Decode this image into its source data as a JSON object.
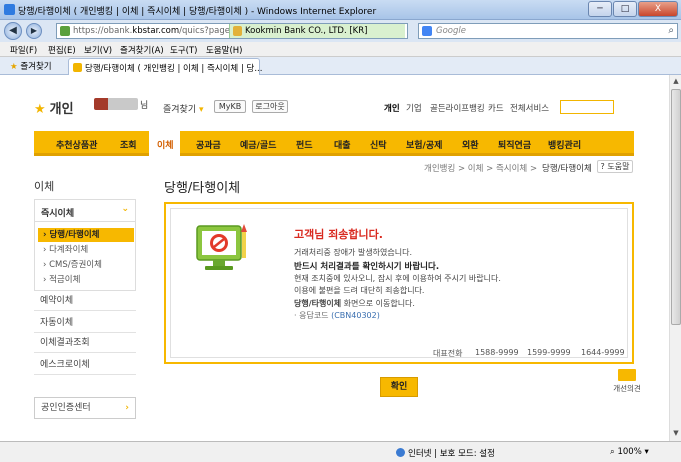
{
  "window": {
    "title": "당행/타행이체 ( 개인뱅킹 | 이체 | 즉시이체 | 당행/타행이체 ) - Windows Internet Explorer",
    "min": "─",
    "max": "□",
    "close": "X"
  },
  "address": {
    "url_prefix": "https://obank.",
    "url_host": "kbstar.com",
    "url_rest": "/quics?page=C01i",
    "cert": "Kookmin Bank CO., LTD. [KR]",
    "search_placeholder": "Google"
  },
  "menu": [
    "파일(F)",
    "편집(E)",
    "보기(V)",
    "즐겨찾기(A)",
    "도구(T)",
    "도움말(H)"
  ],
  "favorites_label": "즐겨찾기",
  "tab_title": "당행/타행이체 ( 개인뱅킹 | 이체 | 즉시이체 | 당...",
  "header": {
    "logo": "개인",
    "user_suffix": "님",
    "favorites": "즐겨찾기",
    "mykb": "MyKB",
    "logout": "로그아웃",
    "links": [
      "개인",
      "기업",
      "골든라이프뱅킹",
      "카드",
      "전체서비스"
    ]
  },
  "gnb": [
    "추천상품관",
    "조회",
    "이체",
    "공과금",
    "예금/골드",
    "펀드",
    "대출",
    "신탁",
    "보험/공제",
    "외환",
    "퇴직연금",
    "뱅킹관리"
  ],
  "breadcrumb": {
    "path": "개인뱅킹 > 이체 > 즉시이체 > ",
    "current": "당행/타행이체",
    "help": "도움말"
  },
  "sidebar": {
    "title": "이체",
    "current": "즉시이체",
    "sub": [
      "당행/타행이체",
      "다계좌이체",
      "CMS/증권이체",
      "적금이체"
    ],
    "items": [
      "예약이체",
      "자동이체",
      "이체결과조회",
      "에스크로이체"
    ],
    "cert": "공인인증센터"
  },
  "page_title": "당행/타행이체",
  "error": {
    "heading": "고객님 죄송합니다.",
    "line1": "거래처리중 장애가 발생하였습니다.",
    "line2": "반드시 처리결과를 확인하시기 바랍니다.",
    "line3": "현재 조치중에 있사오니, 잠시 후에 이용하여 주시기 바랍니다.",
    "line4": "이용에 불편을 드려 대단히 죄송합니다.",
    "line5_bold": "당행/타행이체",
    "line5_rest": " 화면으로 이동합니다.",
    "code_label": "응답코드",
    "code": "(CBN40302)"
  },
  "contact": {
    "label": "대표전화",
    "numbers": [
      "1588-9999",
      "1599-9999",
      "1644-9999"
    ]
  },
  "ok_button": "확인",
  "opinion": "개선의견",
  "status": {
    "zone": "인터넷 | 보호 모드: 설정",
    "zoom": "100%"
  }
}
